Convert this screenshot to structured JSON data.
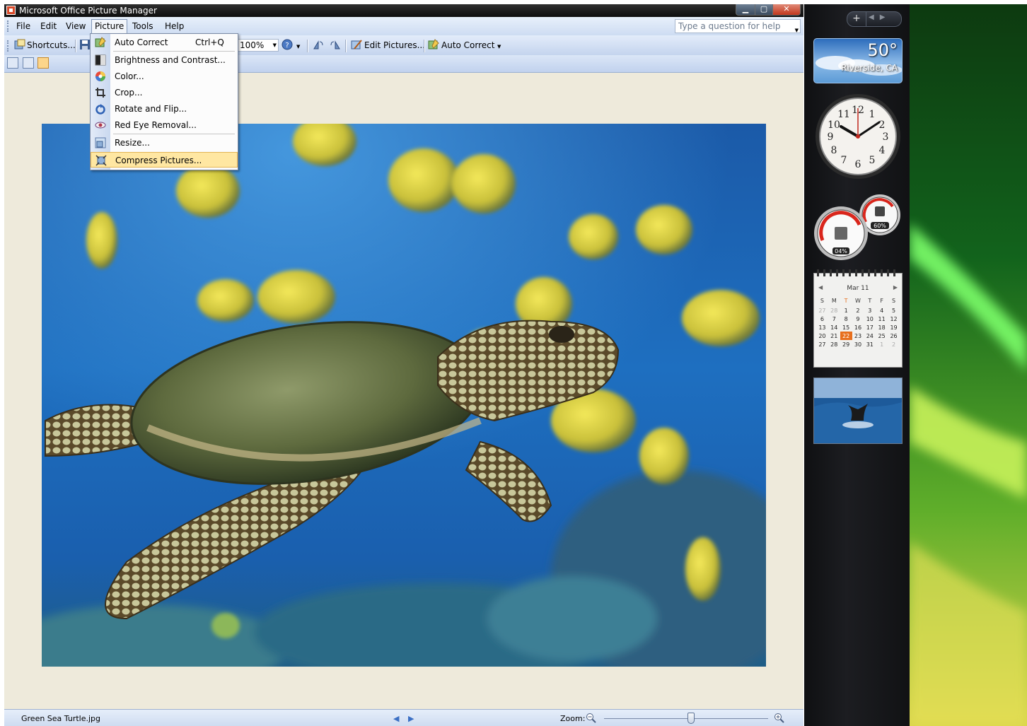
{
  "window": {
    "title": "Microsoft Office Picture Manager",
    "minimize": "▁",
    "maximize": "▢",
    "close": "✕"
  },
  "menubar": {
    "file": "File",
    "edit": "Edit",
    "view": "View",
    "picture": "Picture",
    "tools": "Tools",
    "help": "Help",
    "help_placeholder": "Type a question for help"
  },
  "toolbar": {
    "shortcuts": "Shortcuts...",
    "zoom_value": "100%",
    "edit_pictures": "Edit Pictures...",
    "auto_correct": "Auto Correct"
  },
  "picture_menu": {
    "items": [
      {
        "label": "Auto Correct",
        "shortcut": "Ctrl+Q",
        "icon": "auto-correct-icon"
      },
      {
        "label": "Brightness and Contrast...",
        "icon": "brightness-icon"
      },
      {
        "label": "Color...",
        "icon": "color-wheel-icon"
      },
      {
        "label": "Crop...",
        "icon": "crop-icon"
      },
      {
        "label": "Rotate and Flip...",
        "icon": "rotate-icon"
      },
      {
        "label": "Red Eye Removal...",
        "icon": "red-eye-icon"
      },
      {
        "label": "Resize...",
        "icon": "resize-icon"
      },
      {
        "label": "Compress Pictures...",
        "icon": "compress-icon"
      }
    ],
    "highlighted": "Compress Pictures..."
  },
  "statusbar": {
    "filename": "Green Sea Turtle.jpg",
    "zoom_label": "Zoom:",
    "zoom_fraction": 0.53
  },
  "sidebar": {
    "add_button": "+",
    "weather": {
      "temperature": "50°",
      "city": "Riverside, CA"
    },
    "clock": {
      "numbers": [
        "12",
        "1",
        "2",
        "3",
        "4",
        "5",
        "6",
        "7",
        "8",
        "9",
        "10",
        "11"
      ]
    },
    "cpu_meter": {
      "cpu": "04%",
      "memory": "60%"
    },
    "calendar": {
      "month": "Mar 11",
      "weekdays": [
        "S",
        "M",
        "T",
        "W",
        "T",
        "F",
        "S"
      ],
      "weeks": [
        [
          "27",
          "28",
          "1",
          "2",
          "3",
          "4",
          "5"
        ],
        [
          "6",
          "7",
          "8",
          "9",
          "10",
          "11",
          "12"
        ],
        [
          "13",
          "14",
          "15",
          "16",
          "17",
          "18",
          "19"
        ],
        [
          "20",
          "21",
          "22",
          "23",
          "24",
          "25",
          "26"
        ],
        [
          "27",
          "28",
          "29",
          "30",
          "31",
          "1",
          "2"
        ]
      ],
      "today": "22"
    }
  },
  "colors": {
    "menu_highlight": "#ffe7a2",
    "toolbar_blue": "#cddcf2",
    "canvas_bg": "#eeeadb",
    "calendar_today": "#e76f1d"
  }
}
